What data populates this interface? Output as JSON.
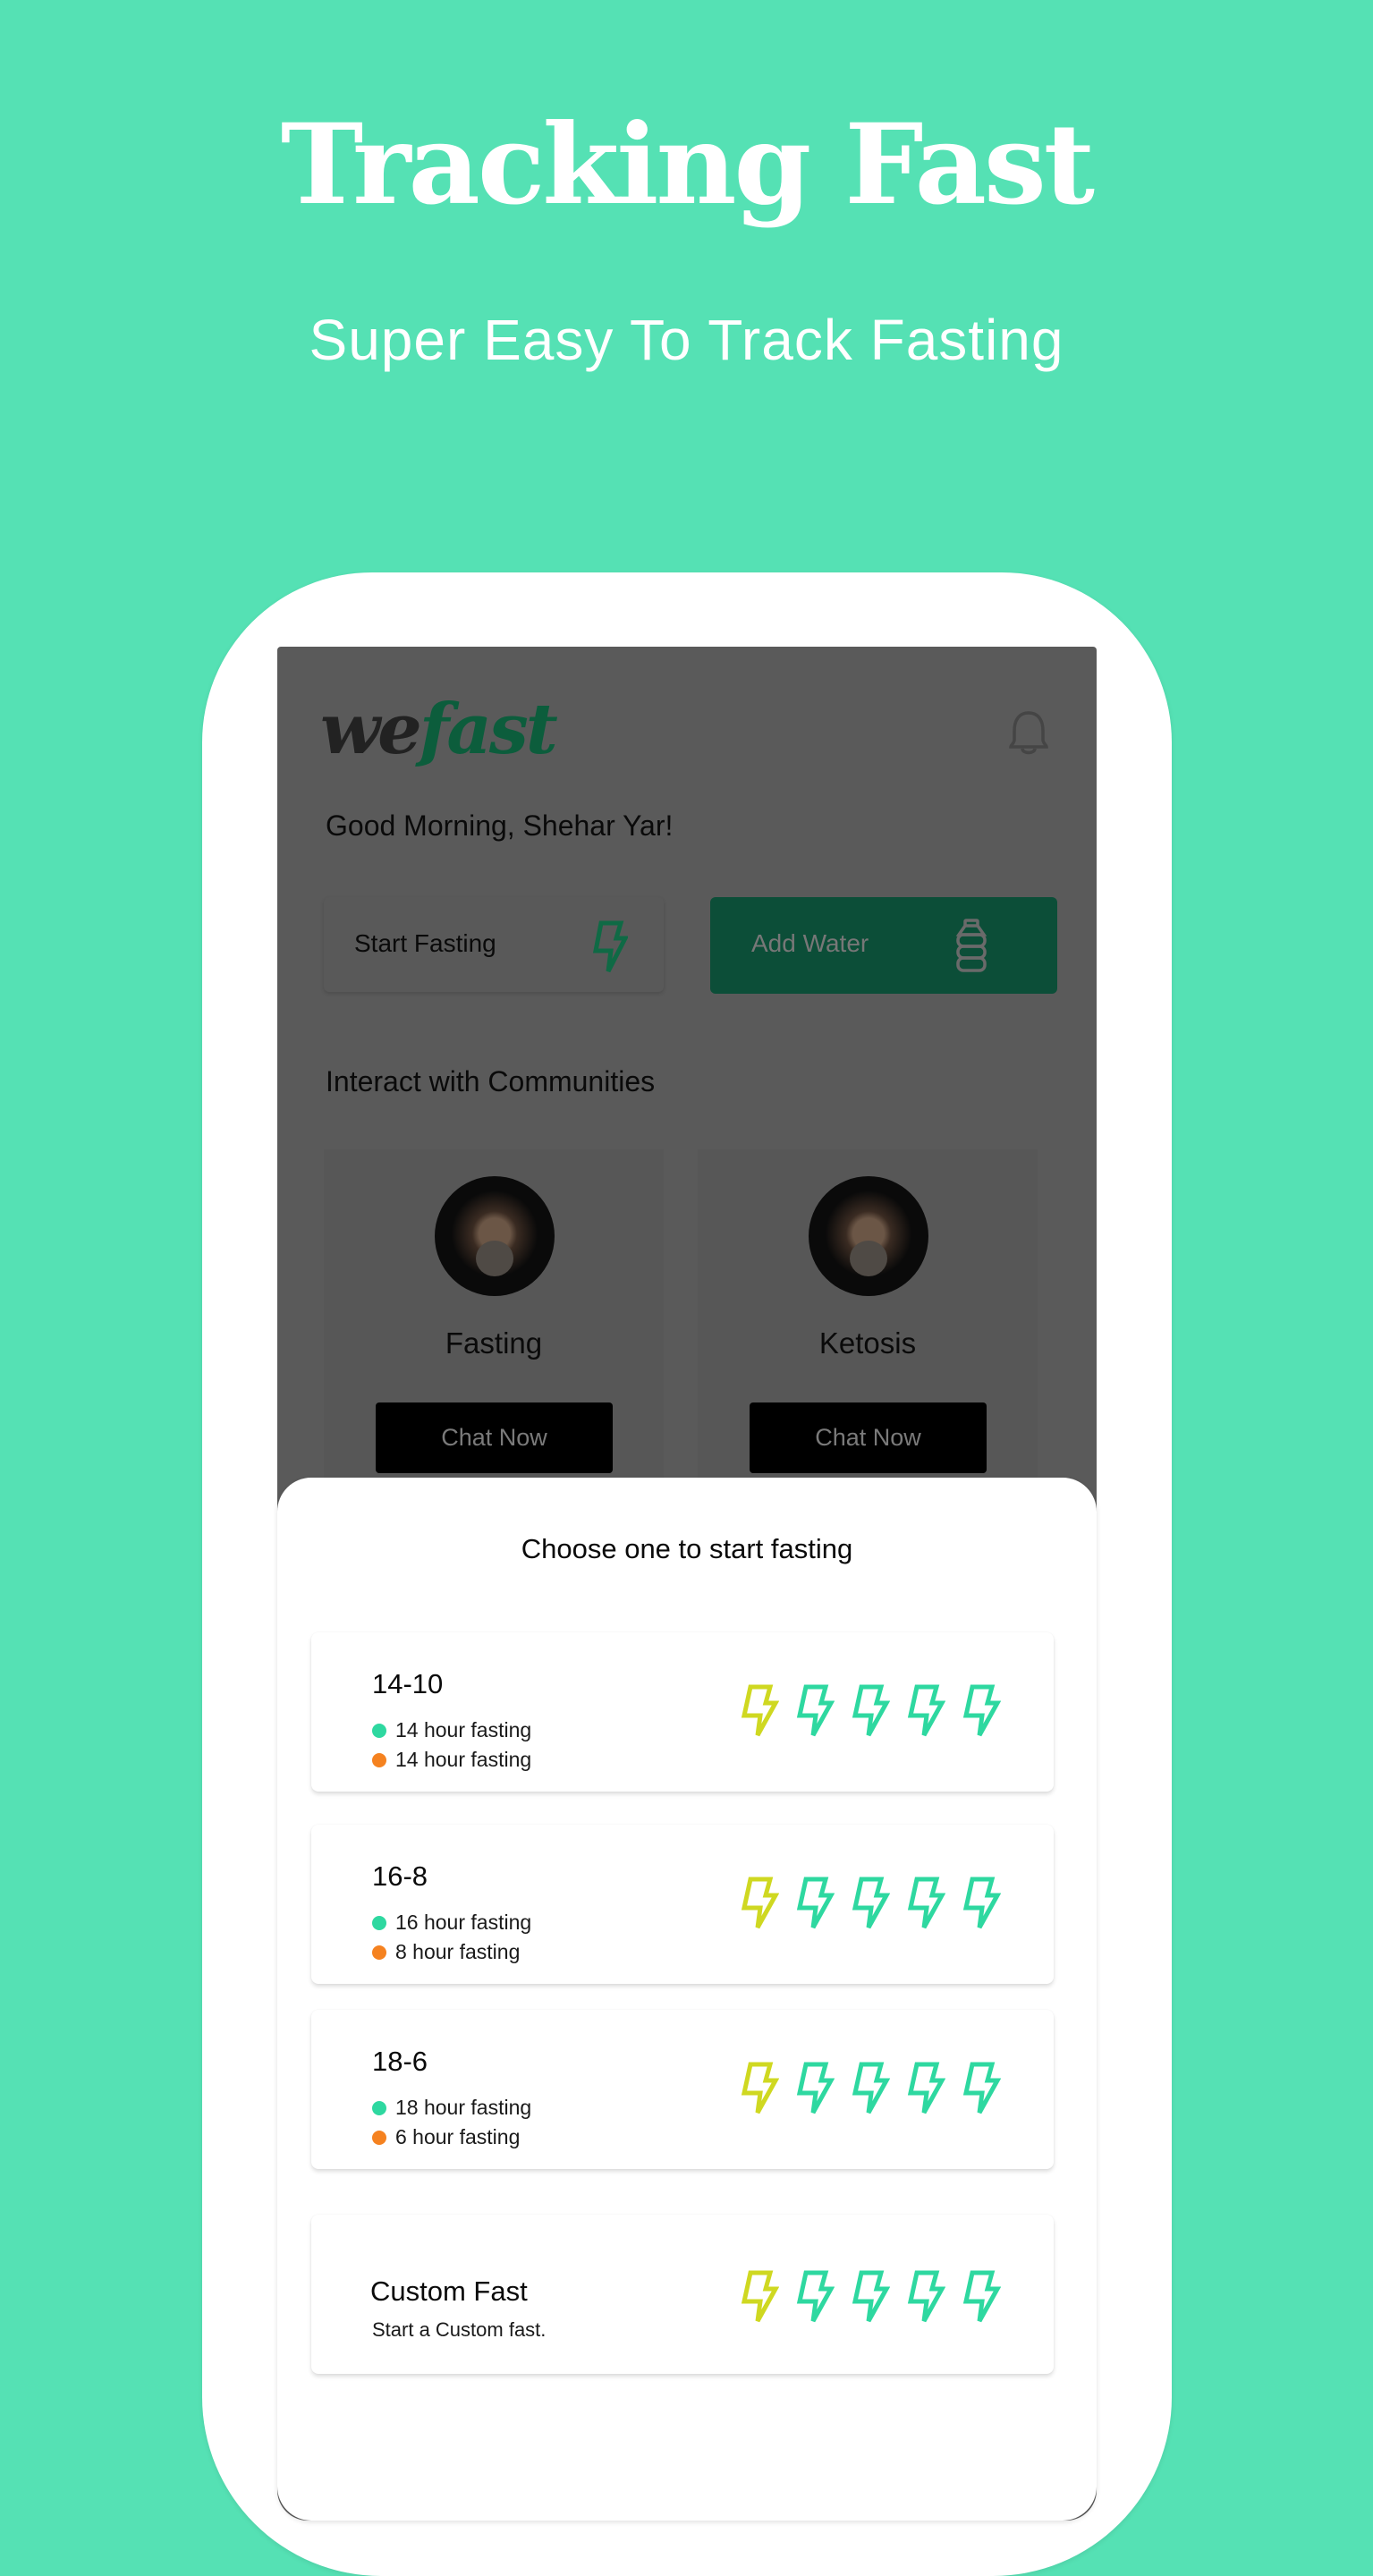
{
  "hero": {
    "title": "Tracking Fast",
    "subtitle": "Super Easy To Track Fasting"
  },
  "colors": {
    "background": "#55e1b4",
    "brand_dark_green": "#0c5d3c",
    "bolt_yellow": "#cfd821",
    "bolt_green": "#2ed8a0",
    "dot_green": "#2ed8a0",
    "dot_orange": "#f58220"
  },
  "app": {
    "logo": {
      "part1": "we",
      "part2": "fast"
    },
    "notification_icon": "bell-icon",
    "greeting": "Good Morning, Shehar Yar!",
    "actions": [
      {
        "label": "Start Fasting",
        "icon": "lightning-bolt-icon"
      },
      {
        "label": "Add Water",
        "icon": "water-bottle-icon"
      }
    ],
    "communities_title": "Interact with Communities",
    "communities": [
      {
        "name": "Fasting",
        "button": "Chat Now"
      },
      {
        "name": "Ketosis",
        "button": "Chat Now"
      }
    ]
  },
  "sheet": {
    "title": "Choose one to start fasting",
    "plans": [
      {
        "name": "14-10",
        "fasting": "14 hour fasting",
        "eating": "14 hour fasting",
        "bolts": 5,
        "highlighted_bolts": 1
      },
      {
        "name": "16-8",
        "fasting": "16 hour fasting",
        "eating": "8 hour fasting",
        "bolts": 5,
        "highlighted_bolts": 1
      },
      {
        "name": "18-6",
        "fasting": "18 hour fasting",
        "eating": " 6 hour fasting",
        "bolts": 5,
        "highlighted_bolts": 1
      }
    ],
    "custom": {
      "name": "Custom Fast",
      "description": "Start a Custom fast.",
      "bolts": 5,
      "highlighted_bolts": 1
    }
  }
}
